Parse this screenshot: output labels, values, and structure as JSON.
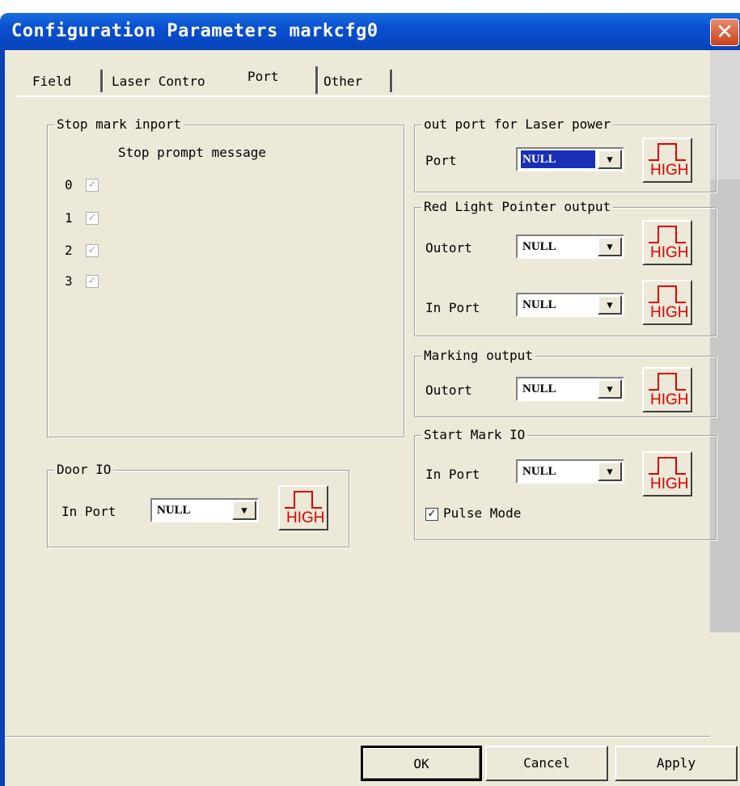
{
  "window": {
    "title": "Configuration Parameters markcfg0",
    "close_glyph": "✕"
  },
  "tabs": [
    {
      "label": "Field"
    },
    {
      "label": "Laser Contro"
    },
    {
      "label": "Port",
      "selected": true
    },
    {
      "label": "Other"
    }
  ],
  "stop_mark": {
    "legend": "Stop mark inport",
    "prompt_header": "Stop prompt message",
    "rows": [
      {
        "label": "0",
        "checked": true,
        "enabled": false
      },
      {
        "label": "1",
        "checked": true,
        "enabled": false
      },
      {
        "label": "2",
        "checked": true,
        "enabled": false
      },
      {
        "label": "3",
        "checked": true,
        "enabled": false
      }
    ]
  },
  "door_io": {
    "legend": "Door IO",
    "port_label": "In Port",
    "port_value": "NULL",
    "level": "HIGH"
  },
  "laser_power": {
    "legend": "out port for Laser power",
    "port_label": "Port",
    "port_value": "NULL",
    "level": "HIGH"
  },
  "red_light": {
    "legend": "Red Light Pointer output",
    "out_label": "Outort",
    "out_value": "NULL",
    "out_level": "HIGH",
    "in_label": "In Port",
    "in_value": "NULL",
    "in_level": "HIGH"
  },
  "marking_output": {
    "legend": "Marking output",
    "out_label": "Outort",
    "out_value": "NULL",
    "level": "HIGH"
  },
  "start_mark": {
    "legend": "Start Mark IO",
    "in_label": "In Port",
    "in_value": "NULL",
    "level": "HIGH",
    "pulse_label": "Pulse Mode",
    "pulse_checked": true
  },
  "buttons": {
    "ok": "OK",
    "cancel": "Cancel",
    "apply": "Apply"
  },
  "icons": {
    "check": "check-icon",
    "dropdown": "dropdown-arrow-icon",
    "level": "high-level-pulse-icon"
  },
  "colors": {
    "title_bar": "#0a4fd0",
    "dialog_bg": "#ece9d8",
    "high_text": "#e00000",
    "selection": "#1a2fb8"
  }
}
